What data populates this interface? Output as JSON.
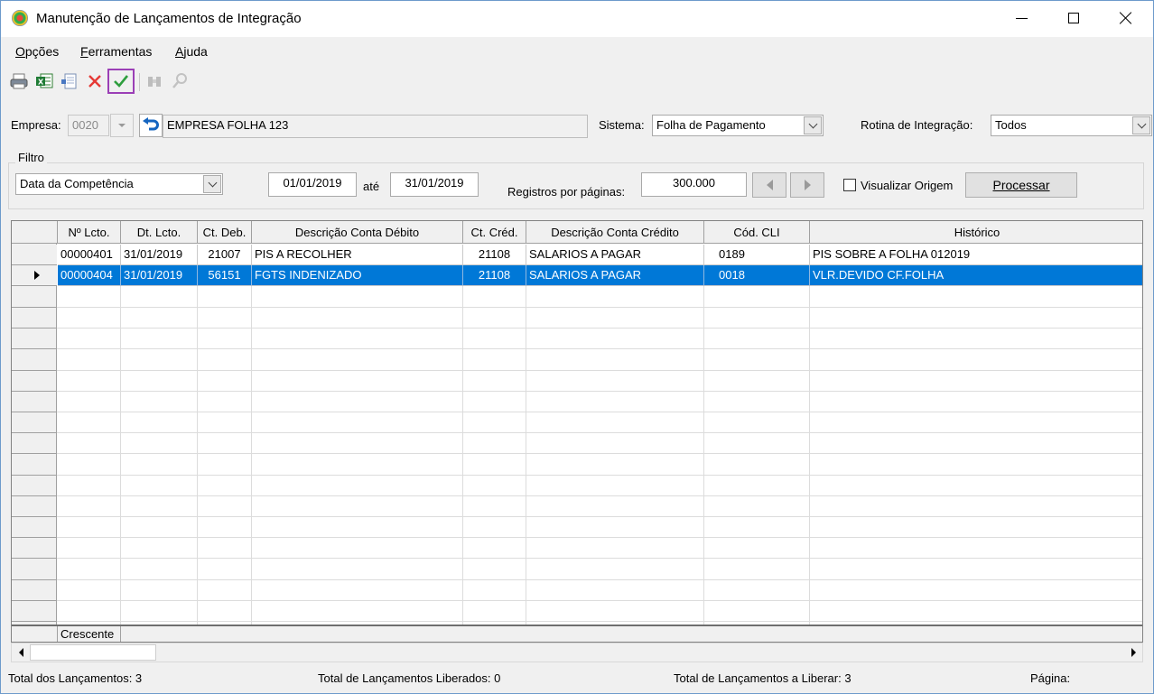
{
  "window": {
    "title": "Manutenção de Lançamentos de Integração"
  },
  "menu": [
    {
      "label": "Opções",
      "accel": "O"
    },
    {
      "label": "Ferramentas",
      "accel": "F"
    },
    {
      "label": "Ajuda",
      "accel": "A"
    }
  ],
  "toolbar": {
    "icons": [
      "printer-icon",
      "excel-export-icon",
      "document-icon",
      "delete-icon",
      "confirm-icon",
      "binoculars-icon",
      "search-icon"
    ],
    "highlight_color": "#9b3fb6"
  },
  "header": {
    "empresa_label": "Empresa:",
    "empresa_code": "0020",
    "empresa_name": "EMPRESA FOLHA 123",
    "sistema_label": "Sistema:",
    "sistema_value": "Folha de Pagamento",
    "rotina_label": "Rotina de Integração:",
    "rotina_value": "Todos"
  },
  "filter": {
    "group_title": "Filtro",
    "date_type": "Data da Competência",
    "date_from": "01/01/2019",
    "ate_label": "até",
    "date_to": "31/01/2019",
    "registros_label": "Registros por páginas:",
    "registros_value": "300.000",
    "visualizar_label": "Visualizar Origem",
    "visualizar_checked": false,
    "processar_label": "Processar"
  },
  "grid": {
    "columns": [
      "Nº Lcto.",
      "Dt. Lcto.",
      "Ct. Deb.",
      "Descrição Conta Débito",
      "Ct. Créd.",
      "Descrição Conta Crédito",
      "Cód. CLI",
      "Histórico"
    ],
    "rows": [
      {
        "nlcto": "00000401",
        "dtlcto": "31/01/2019",
        "ctdeb": "21007",
        "descdeb": "PIS A RECOLHER",
        "ctcred": "21108",
        "desccred": "SALARIOS A PAGAR",
        "codcli": "0189",
        "historico": "PIS SOBRE A FOLHA 012019",
        "selected": false
      },
      {
        "nlcto": "00000404",
        "dtlcto": "31/01/2019",
        "ctdeb": "56151",
        "descdeb": "FGTS INDENIZADO",
        "ctcred": "21108",
        "desccred": "SALARIOS A PAGAR",
        "codcli": "0018",
        "historico": "VLR.DEVIDO CF.FOLHA",
        "selected": true
      }
    ],
    "footer_sort": "Crescente",
    "selection_color": "#0078d7"
  },
  "status": {
    "total": "Total dos Lançamentos: 3",
    "liberados": "Total de Lançamentos Liberados: 0",
    "a_liberar": "Total de Lançamentos a Liberar: 3",
    "pagina": "Página:"
  }
}
